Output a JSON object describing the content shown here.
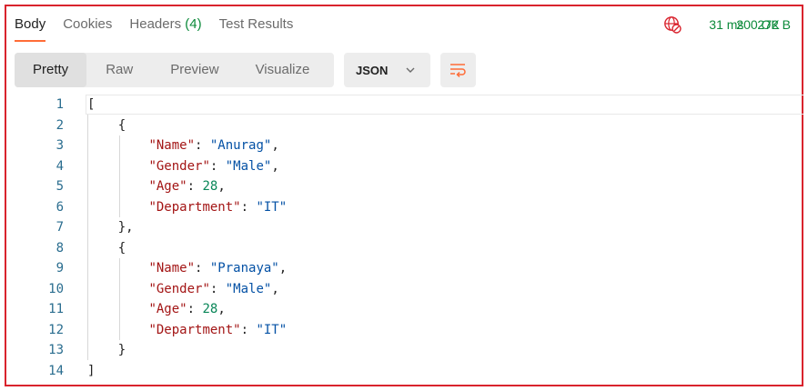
{
  "tabs": [
    {
      "label": "Body"
    },
    {
      "label": "Cookies"
    },
    {
      "label": "Headers",
      "count": "(4)"
    },
    {
      "label": "Test Results"
    }
  ],
  "status": {
    "code": "200 OK",
    "time": "31 ms",
    "size": "272 B",
    "globe_icon": "globe-blocked-icon",
    "colors": {
      "ok": "#0c8a3a",
      "globe": "#d9232d"
    }
  },
  "view_modes": [
    "Pretty",
    "Raw",
    "Preview",
    "Visualize"
  ],
  "active_view": "Pretty",
  "language": "JSON",
  "wrap_icon": "wrap-lines-icon",
  "accent": "#ff6c37",
  "frame_color": "#d9232d",
  "code_lines": [
    {
      "n": "1",
      "t": "["
    },
    {
      "n": "2",
      "t": "    {"
    },
    {
      "n": "3",
      "t": "        \"Name\": \"Anurag\","
    },
    {
      "n": "4",
      "t": "        \"Gender\": \"Male\","
    },
    {
      "n": "5",
      "t": "        \"Age\": 28,"
    },
    {
      "n": "6",
      "t": "        \"Department\": \"IT\""
    },
    {
      "n": "7",
      "t": "    },"
    },
    {
      "n": "8",
      "t": "    {"
    },
    {
      "n": "9",
      "t": "        \"Name\": \"Pranaya\","
    },
    {
      "n": "10",
      "t": "        \"Gender\": \"Male\","
    },
    {
      "n": "11",
      "t": "        \"Age\": 28,"
    },
    {
      "n": "12",
      "t": "        \"Department\": \"IT\""
    },
    {
      "n": "13",
      "t": "    }"
    },
    {
      "n": "14",
      "t": "]"
    }
  ]
}
